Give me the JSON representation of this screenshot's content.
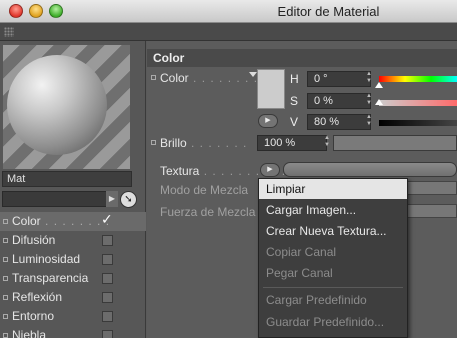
{
  "window": {
    "title": "Editor de Material"
  },
  "left": {
    "material_name": "Mat",
    "channels": [
      {
        "label": "Color",
        "dots": " . . . . . . . . ",
        "checked": true,
        "selected": true
      },
      {
        "label": "Difusión",
        "dots": "",
        "checked": false,
        "selected": false
      },
      {
        "label": "Luminosidad",
        "dots": "",
        "checked": false,
        "selected": false
      },
      {
        "label": "Transparencia",
        "dots": "",
        "checked": false,
        "selected": false
      },
      {
        "label": "Reflexión",
        "dots": "",
        "checked": false,
        "selected": false
      },
      {
        "label": "Entorno",
        "dots": "",
        "checked": false,
        "selected": false
      },
      {
        "label": "Niebla",
        "dots": "",
        "checked": false,
        "selected": false
      }
    ]
  },
  "right": {
    "section_title": "Color",
    "color": {
      "label": "Color",
      "dots": " . . . . . . . .",
      "h_label": "H",
      "h_value": "0 °",
      "s_label": "S",
      "s_value": "0 %",
      "v_label": "V",
      "v_value": "80 %",
      "h_level": 0.0,
      "s_level": 0.0,
      "v_level": 0.8,
      "swatch_color": "#cccccc"
    },
    "brillo": {
      "label": "Brillo",
      "dots": " . . . . . . . ",
      "value": "100 %"
    },
    "textura": {
      "label": "Textura",
      "dots": " . . . . . . . . . ."
    },
    "modo_mezcla": {
      "label": "Modo de Mezcla"
    },
    "fuerza_mezcla": {
      "label": "Fuerza de Mezcla"
    }
  },
  "menu": {
    "items": [
      {
        "label": "Limpiar",
        "enabled": true,
        "highlight": true
      },
      {
        "label": "Cargar Imagen...",
        "enabled": true
      },
      {
        "label": "Crear Nueva Textura...",
        "enabled": true
      },
      {
        "label": "Copiar Canal",
        "enabled": false
      },
      {
        "label": "Pegar Canal",
        "enabled": false
      },
      {
        "label": "Cargar Predefinido",
        "enabled": false
      },
      {
        "label": "Guardar Predefinido...",
        "enabled": false
      }
    ]
  }
}
